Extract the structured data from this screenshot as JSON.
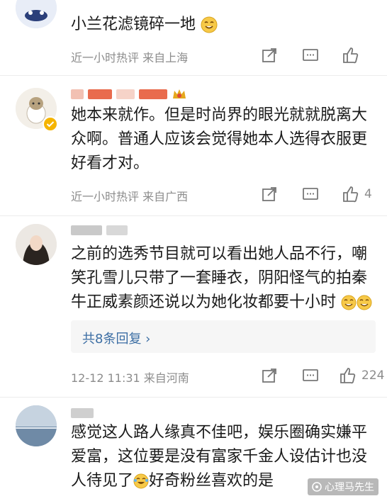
{
  "comments": [
    {
      "text": "小兰花滤镜碎一地",
      "meta": "近一小时热评  来自上海",
      "likes": "",
      "emoji": "smile-emoji"
    },
    {
      "text": "她本来就作。但是时尚界的眼光就就脱离大众啊。普通人应该会觉得她本人选得衣服更好看才对。",
      "meta": "近一小时热评  来自广西",
      "likes": "4"
    },
    {
      "text": "之前的选秀节目就可以看出她人品不行，嘲笑孔雪儿只带了一套睡衣，阴阳怪气的拍秦牛正威素颜还说以为她化妆都要十小时",
      "meta": "12-12 11:31  来自河南",
      "likes": "224",
      "reply_label": "共8条回复 ›"
    },
    {
      "text": "感觉这人路人缘真不佳吧，娱乐圈确实嫌平爱富，这位要是没有富家千金人设估计也没人待见了",
      "text_tail": "好奇粉丝喜欢的是"
    }
  ],
  "watermark": "心理马先生",
  "colors": {
    "link": "#3c6ea4",
    "meta": "#8c8c8c",
    "crown": "#e5a81c",
    "name_blur": "#e96b4d"
  }
}
